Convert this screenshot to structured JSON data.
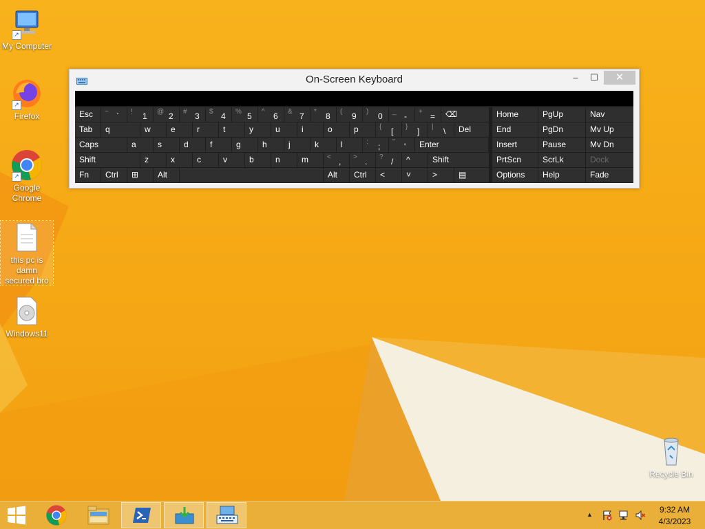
{
  "desktop": {
    "icons": [
      {
        "label": "My Computer"
      },
      {
        "label": "Firefox"
      },
      {
        "label": "Google Chrome"
      },
      {
        "label": "this pc is damn secured bro"
      },
      {
        "label": "Windows11"
      },
      {
        "label": "Recycle Bin"
      }
    ]
  },
  "osk": {
    "title": "On-Screen Keyboard",
    "min_label": "–",
    "max_label": "☐",
    "close_label": "✕",
    "rows": [
      [
        {
          "label": "Esc"
        },
        {
          "shift": "~",
          "main": "`"
        },
        {
          "shift": "!",
          "main": "1"
        },
        {
          "shift": "@",
          "main": "2"
        },
        {
          "shift": "#",
          "main": "3"
        },
        {
          "shift": "$",
          "main": "4"
        },
        {
          "shift": "%",
          "main": "5"
        },
        {
          "shift": "^",
          "main": "6"
        },
        {
          "shift": "&",
          "main": "7"
        },
        {
          "shift": "*",
          "main": "8"
        },
        {
          "shift": "(",
          "main": "9"
        },
        {
          "shift": ")",
          "main": "0"
        },
        {
          "shift": "_",
          "main": "-"
        },
        {
          "shift": "+",
          "main": "="
        },
        {
          "label": "⌫"
        }
      ],
      [
        {
          "label": "Tab"
        },
        {
          "label": "q"
        },
        {
          "label": "w"
        },
        {
          "label": "e"
        },
        {
          "label": "r"
        },
        {
          "label": "t"
        },
        {
          "label": "y"
        },
        {
          "label": "u"
        },
        {
          "label": "i"
        },
        {
          "label": "o"
        },
        {
          "label": "p"
        },
        {
          "shift": "{",
          "main": "["
        },
        {
          "shift": "}",
          "main": "]"
        },
        {
          "shift": "|",
          "main": "\\"
        },
        {
          "label": "Del"
        }
      ],
      [
        {
          "label": "Caps"
        },
        {
          "label": "a"
        },
        {
          "label": "s"
        },
        {
          "label": "d"
        },
        {
          "label": "f"
        },
        {
          "label": "g"
        },
        {
          "label": "h"
        },
        {
          "label": "j"
        },
        {
          "label": "k"
        },
        {
          "label": "l"
        },
        {
          "shift": ":",
          "main": ";"
        },
        {
          "shift": "\"",
          "main": "'"
        },
        {
          "label": "Enter"
        }
      ],
      [
        {
          "label": "Shift"
        },
        {
          "label": "z"
        },
        {
          "label": "x"
        },
        {
          "label": "c"
        },
        {
          "label": "v"
        },
        {
          "label": "b"
        },
        {
          "label": "n"
        },
        {
          "label": "m"
        },
        {
          "shift": "<",
          "main": ","
        },
        {
          "shift": ">",
          "main": "."
        },
        {
          "shift": "?",
          "main": "/"
        },
        {
          "label": "^"
        },
        {
          "label": "Shift"
        }
      ],
      [
        {
          "label": "Fn"
        },
        {
          "label": "Ctrl"
        },
        {
          "label": "⊞"
        },
        {
          "label": "Alt"
        },
        {
          "label": ""
        },
        {
          "label": "Alt"
        },
        {
          "label": "Ctrl"
        },
        {
          "label": "<"
        },
        {
          "label": "˅"
        },
        {
          "label": ">"
        },
        {
          "label": "▤"
        }
      ]
    ],
    "nav_keys": [
      [
        "Home",
        "PgUp",
        "Nav"
      ],
      [
        "End",
        "PgDn",
        "Mv Up"
      ],
      [
        "Insert",
        "Pause",
        "Mv Dn"
      ],
      [
        "PrtScn",
        "ScrLk",
        "Dock"
      ],
      [
        "Options",
        "Help",
        "Fade"
      ]
    ]
  },
  "taskbar": {
    "clock_time": "9:32 AM",
    "clock_date": "4/3/2023",
    "tray_overflow": "▲"
  },
  "colors": {
    "accent": "#f5a714",
    "key": "#2f2f2f",
    "keyboard_bg": "#1e1e1e"
  }
}
